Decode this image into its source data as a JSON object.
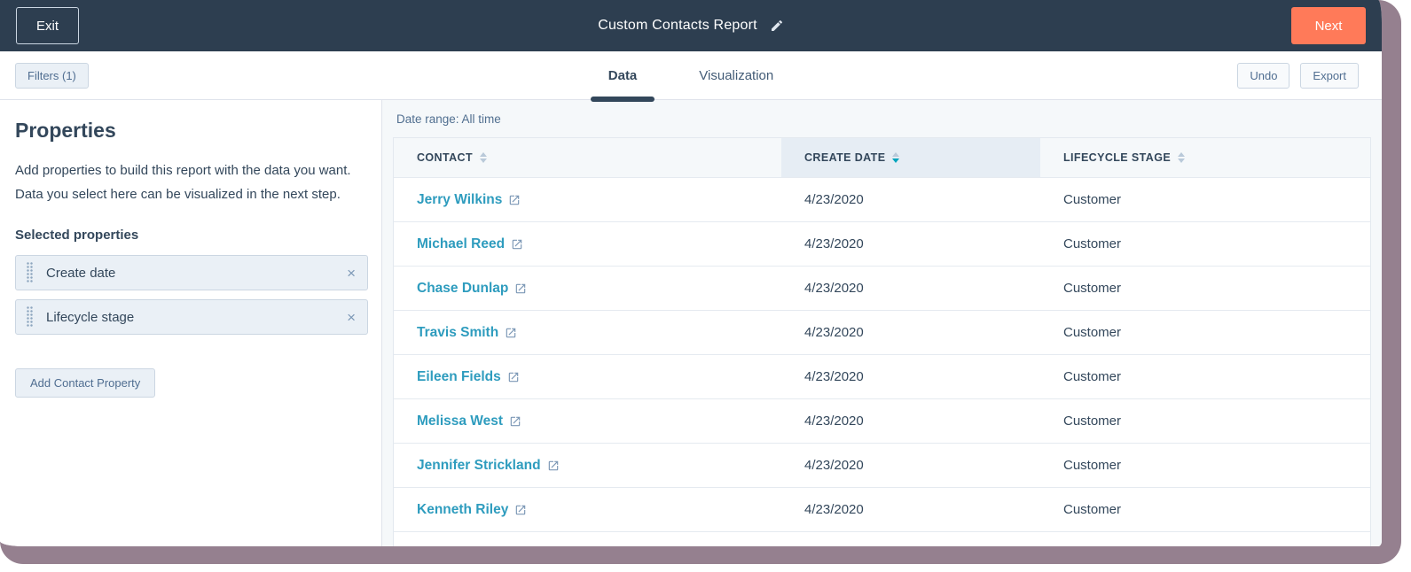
{
  "topbar": {
    "exit_label": "Exit",
    "title": "Custom Contacts Report",
    "next_label": "Next"
  },
  "toolbar": {
    "filters_label": "Filters (1)",
    "tabs": [
      {
        "label": "Data",
        "active": true
      },
      {
        "label": "Visualization",
        "active": false
      }
    ],
    "undo_label": "Undo",
    "export_label": "Export"
  },
  "sidebar": {
    "title": "Properties",
    "description": "Add properties to build this report with the data you want. Data you select here can be visualized in the next step.",
    "selected_label": "Selected properties",
    "properties": [
      {
        "label": "Create date"
      },
      {
        "label": "Lifecycle stage"
      }
    ],
    "add_button_label": "Add Contact Property"
  },
  "report": {
    "date_range_label": "Date range: All time",
    "table": {
      "columns": [
        {
          "label": "CONTACT",
          "sort": "none"
        },
        {
          "label": "CREATE DATE",
          "sort": "desc"
        },
        {
          "label": "LIFECYCLE STAGE",
          "sort": "none"
        }
      ],
      "rows": [
        {
          "contact": "Jerry Wilkins",
          "create_date": "4/23/2020",
          "lifecycle_stage": "Customer"
        },
        {
          "contact": "Michael Reed",
          "create_date": "4/23/2020",
          "lifecycle_stage": "Customer"
        },
        {
          "contact": "Chase Dunlap",
          "create_date": "4/23/2020",
          "lifecycle_stage": "Customer"
        },
        {
          "contact": "Travis Smith",
          "create_date": "4/23/2020",
          "lifecycle_stage": "Customer"
        },
        {
          "contact": "Eileen Fields",
          "create_date": "4/23/2020",
          "lifecycle_stage": "Customer"
        },
        {
          "contact": "Melissa West",
          "create_date": "4/23/2020",
          "lifecycle_stage": "Customer"
        },
        {
          "contact": "Jennifer Strickland",
          "create_date": "4/23/2020",
          "lifecycle_stage": "Customer"
        },
        {
          "contact": "Kenneth Riley",
          "create_date": "4/23/2020",
          "lifecycle_stage": "Customer"
        }
      ]
    }
  },
  "icons": {
    "edit": "edit-pencil-icon",
    "external_link": "external-link-icon",
    "sort": "sort-carets-icon",
    "drag": "drag-handle-icon",
    "remove": "remove-x-icon"
  },
  "colors": {
    "topbar_bg": "#2d3e50",
    "primary_button_bg": "#ff7a59",
    "link_teal": "#2e9cbe",
    "text_dark": "#33475b",
    "text_secondary": "#516f90",
    "chip_bg": "#eaf0f6",
    "panel_bg": "#f5f8fa",
    "sorted_header_bg": "#e6edf4",
    "sort_active": "#00a4bd",
    "border_light": "#cbd6e2",
    "frame_border": "#95808f"
  }
}
